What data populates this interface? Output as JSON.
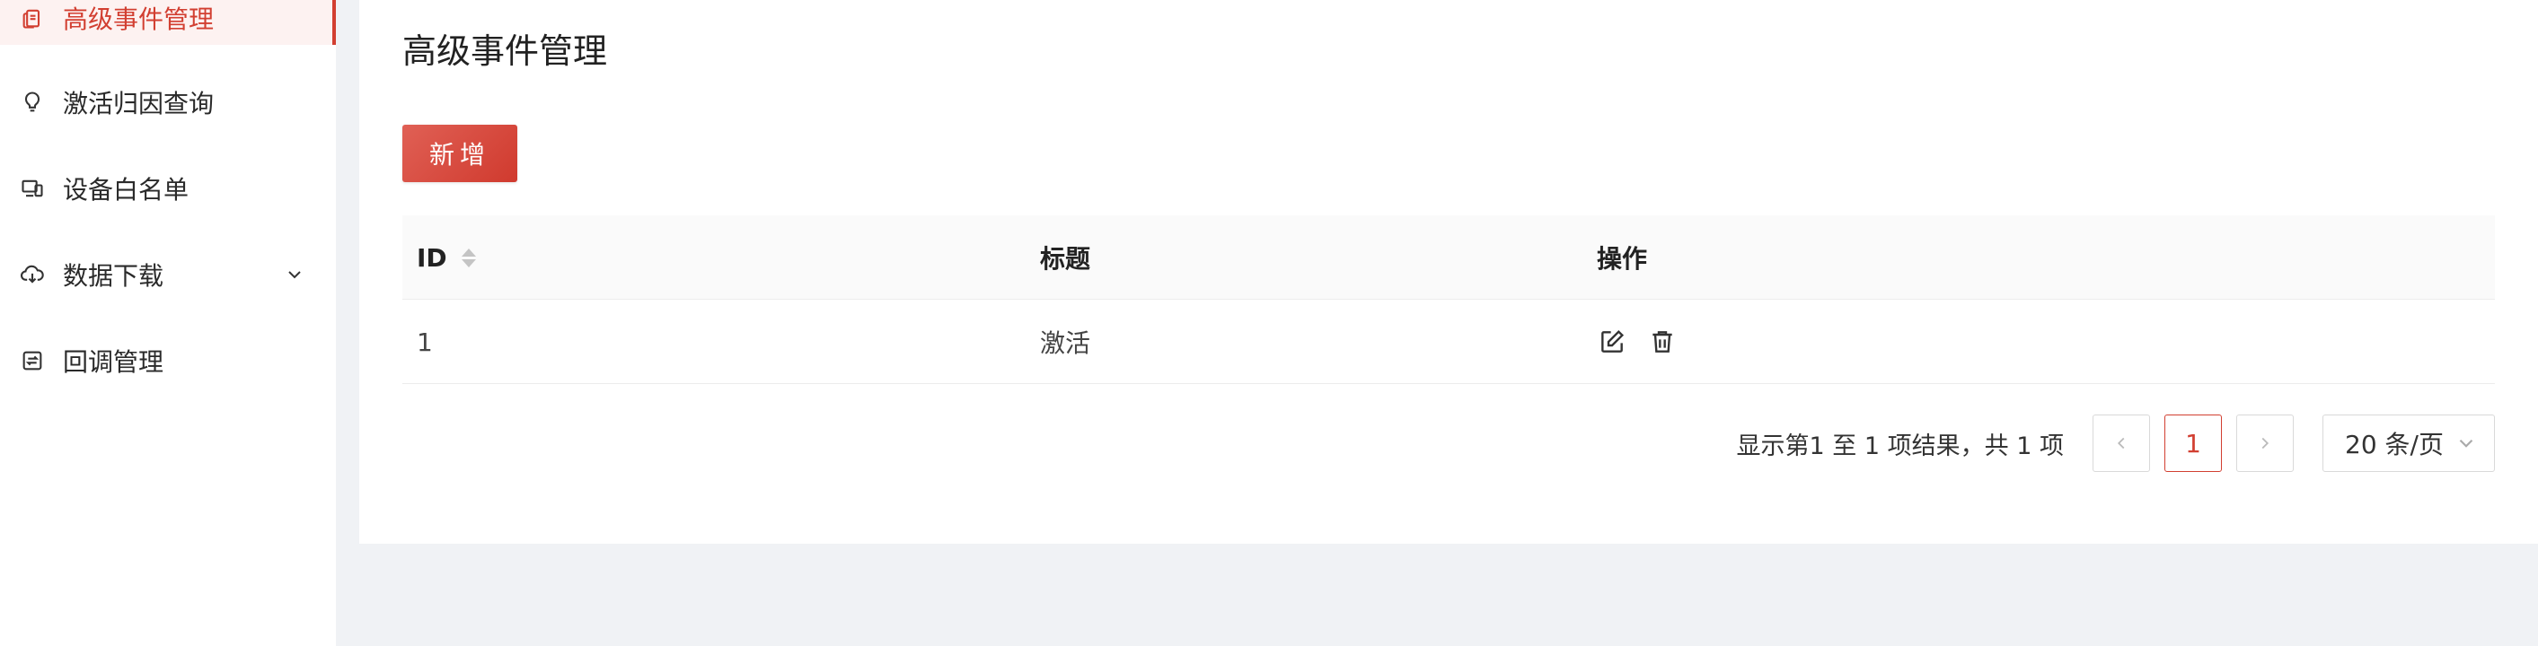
{
  "sidebar": {
    "items": [
      {
        "label": "高级事件管理",
        "icon": "document-copy-icon",
        "active": true
      },
      {
        "label": "激活归因查询",
        "icon": "lightbulb-icon"
      },
      {
        "label": "设备白名单",
        "icon": "devices-icon"
      },
      {
        "label": "数据下载",
        "icon": "cloud-download-icon",
        "has_submenu": true
      },
      {
        "label": "回调管理",
        "icon": "callback-icon"
      }
    ]
  },
  "main": {
    "title": "高级事件管理",
    "add_button_label": "新增",
    "table": {
      "columns": [
        "ID",
        "标题",
        "操作"
      ],
      "rows": [
        {
          "id": "1",
          "title": "激活"
        }
      ]
    },
    "pagination": {
      "summary": "显示第1 至 1 项结果，共 1 项",
      "current_page": "1",
      "page_size": "20 条/页"
    }
  },
  "colors": {
    "accent": "#d23f31",
    "sidebar_bg": "#ffffff",
    "page_bg": "#f0f2f5"
  }
}
